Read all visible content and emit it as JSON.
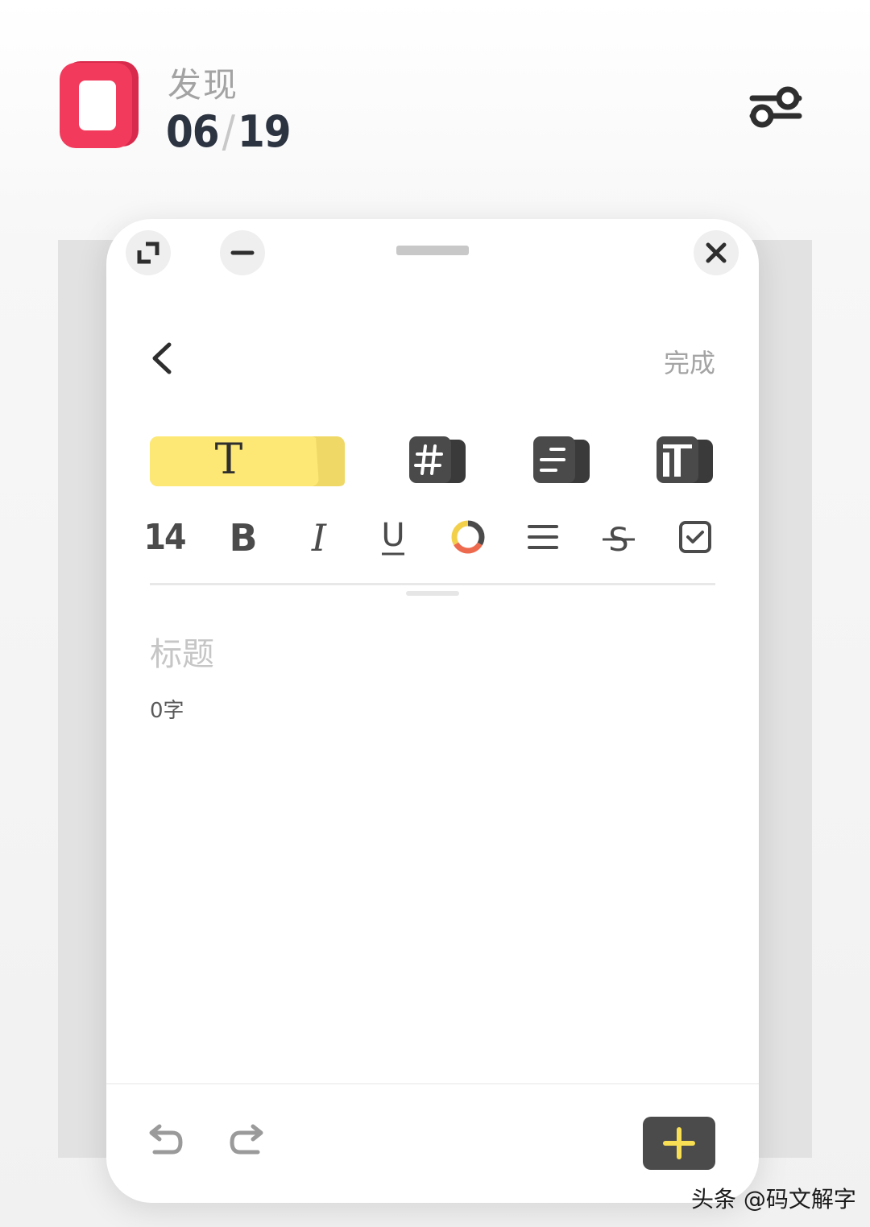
{
  "header": {
    "title": "发现",
    "date_day": "06",
    "date_separator": "/",
    "date_total": "19",
    "logo_icon": "app-logo-icon",
    "filter_icon": "sliders-icon",
    "brand_color": "#f23b5c"
  },
  "window_controls": {
    "expand_icon": "expand-icon",
    "minimize_icon": "minus-icon",
    "close_icon": "close-icon"
  },
  "editor": {
    "back_icon": "chevron-left-icon",
    "done_label": "完成",
    "modes": [
      {
        "name": "text",
        "glyph": "T",
        "active": true
      },
      {
        "name": "tag",
        "glyph": "#"
      },
      {
        "name": "list",
        "glyph": "list"
      },
      {
        "name": "layout",
        "glyph": "layout"
      }
    ],
    "highlight_color": "#fde876",
    "format": {
      "font_size": "14",
      "bold": "B",
      "italic": "I",
      "underline": "U",
      "strikethrough": "S"
    },
    "title_placeholder": "标题",
    "word_count": "0字"
  },
  "bottom_bar": {
    "undo_icon": "undo-icon",
    "redo_icon": "redo-icon",
    "add_icon": "plus-icon",
    "add_color": "#f8df54"
  },
  "watermark": "头条 @码文解字"
}
